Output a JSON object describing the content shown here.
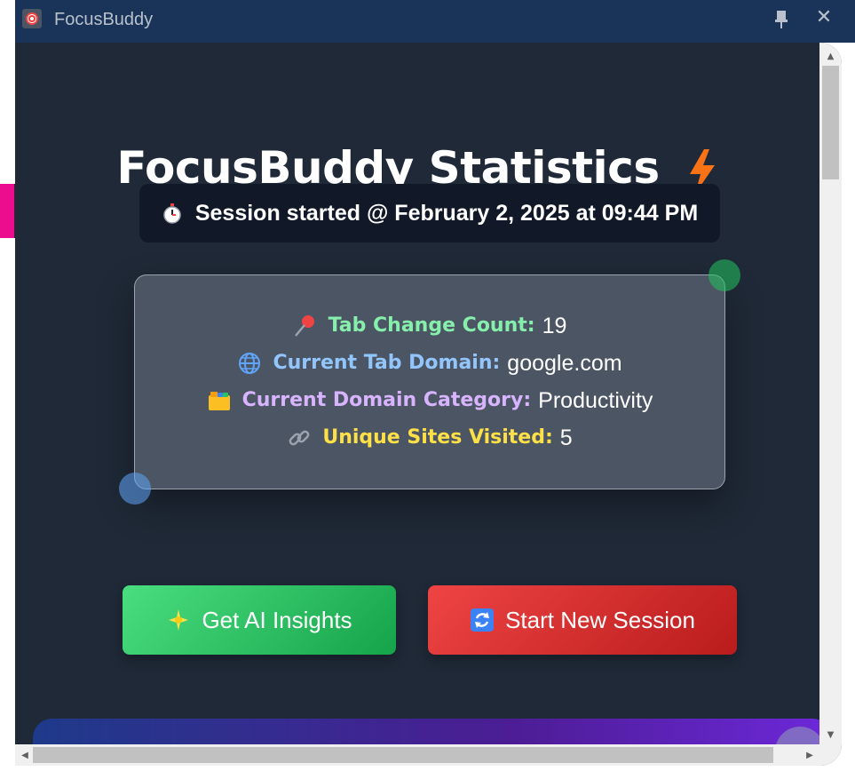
{
  "window": {
    "title": "FocusBuddy",
    "app_icon": "target-icon",
    "controls": [
      "pin-icon",
      "close-icon"
    ]
  },
  "header": {
    "title": "FocusBuddy Statistics",
    "title_icon": "lightning-bolt-icon"
  },
  "session": {
    "icon": "stopwatch-icon",
    "text": "Session started @ February 2, 2025 at 09:44 PM"
  },
  "stats": [
    {
      "icon": "pushpin-icon",
      "label": "Tab Change Count:",
      "value": "19",
      "label_color": "#86efac"
    },
    {
      "icon": "globe-icon",
      "label": "Current Tab Domain:",
      "value": "google.com",
      "label_color": "#93c5fd"
    },
    {
      "icon": "card-index-dividers-icon",
      "label": "Current Domain Category:",
      "value": "Productivity",
      "label_color": "#d8b4fe"
    },
    {
      "icon": "link-icon",
      "label": "Unique Sites Visited:",
      "value": "5",
      "label_color": "#fde047"
    }
  ],
  "buttons": {
    "ai_insights": {
      "label": "Get AI Insights",
      "icon": "sparkle-icon",
      "color": "#22c55e"
    },
    "new_session": {
      "label": "Start New Session",
      "icon": "refresh-icon",
      "color": "#ef4444"
    }
  },
  "colors": {
    "background": "#1f2937",
    "titlebar": "#1a3358",
    "card": "#4b5563",
    "accent_pink": "#ec0d8f"
  }
}
